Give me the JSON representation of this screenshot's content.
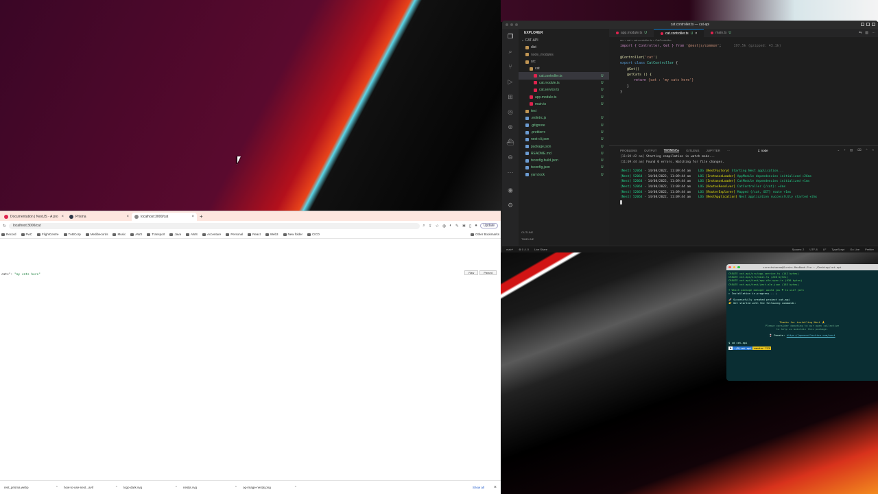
{
  "browser": {
    "tabs": [
      {
        "label": "Documentation | NestJS - A pro",
        "favicon_color": "#e0234e"
      },
      {
        "label": "Prisma",
        "favicon_color": "#2d3748"
      },
      {
        "label": "localhost:3000/cat",
        "favicon_color": "#888888"
      }
    ],
    "new_tab": "+",
    "url": "localhost:3000/cat",
    "update_label": "Update",
    "bookmarks": [
      "Record",
      "PwC",
      "FlightCentre",
      "TABCorp",
      "Medibecords",
      "Music",
      "AWS",
      "Transport",
      "Java",
      "AWS",
      "Accenture",
      "Personal",
      "React",
      "Web3",
      "New folder",
      "CICD"
    ],
    "other_bookmarks": "Other Bookmarks",
    "page": {
      "key": "cats\":",
      "value": "\"my cats here\""
    },
    "raw_label": "Raw",
    "pretty_label": "Parsed",
    "downloads": [
      "rest_prisma.webp",
      "how-to-use-nest...avif",
      "logo-dark.svg",
      "nestjs.svg",
      "og-image-nestjs.png"
    ],
    "show_all": "Show all"
  },
  "vscode": {
    "title": "cat.controller.ts — cat-api",
    "explorer_label": "EXPLORER",
    "project": "CAT-API",
    "tree": [
      {
        "name": "dist",
        "indent": 1,
        "color": "#c5c5c5",
        "status": ""
      },
      {
        "name": "node_modules",
        "indent": 1,
        "color": "#8a8a8a",
        "status": ""
      },
      {
        "name": "src",
        "indent": 1,
        "color": "#c5c5c5",
        "status": ""
      },
      {
        "name": "cat",
        "indent": 2,
        "color": "#c5c5c5",
        "status": ""
      },
      {
        "name": "cat.controller.ts",
        "indent": 3,
        "color": "#73c991",
        "status": "U",
        "selected": true
      },
      {
        "name": "cat.module.ts",
        "indent": 3,
        "color": "#73c991",
        "status": "U"
      },
      {
        "name": "cat.service.ts",
        "indent": 3,
        "color": "#73c991",
        "status": "U"
      },
      {
        "name": "app.module.ts",
        "indent": 2,
        "color": "#73c991",
        "status": "U"
      },
      {
        "name": "main.ts",
        "indent": 2,
        "color": "#73c991",
        "status": "U"
      },
      {
        "name": "test",
        "indent": 1,
        "color": "#73c991",
        "status": ""
      },
      {
        "name": ".eslintrc.js",
        "indent": 1,
        "color": "#73c991",
        "status": "U"
      },
      {
        "name": ".gitignore",
        "indent": 1,
        "color": "#73c991",
        "status": "U"
      },
      {
        "name": ".prettierrc",
        "indent": 1,
        "color": "#73c991",
        "status": "U"
      },
      {
        "name": "nest-cli.json",
        "indent": 1,
        "color": "#73c991",
        "status": "U"
      },
      {
        "name": "package.json",
        "indent": 1,
        "color": "#73c991",
        "status": "U"
      },
      {
        "name": "README.md",
        "indent": 1,
        "color": "#73c991",
        "status": "U"
      },
      {
        "name": "tsconfig.build.json",
        "indent": 1,
        "color": "#73c991",
        "status": "U"
      },
      {
        "name": "tsconfig.json",
        "indent": 1,
        "color": "#73c991",
        "status": "U"
      },
      {
        "name": "yarn.lock",
        "indent": 1,
        "color": "#73c991",
        "status": "U"
      }
    ],
    "outline_label": "OUTLINE",
    "timeline_label": "TIMELINE",
    "editor_tabs": [
      {
        "label": "app.module.ts",
        "status": "U",
        "active": false
      },
      {
        "label": "cat.controller.ts",
        "status": "U",
        "active": true
      },
      {
        "label": "main.ts",
        "status": "U",
        "active": false
      }
    ],
    "breadcrumb": "src > cat > cat.controller.ts > CatController",
    "code": {
      "line1_a": "import { Controller, Get } from ",
      "line1_b": "'@nestjs/common'",
      "line1_c": ";",
      "line1_hint": "197.5k (gzipped: 43.1k)",
      "line3_a": "@Controller(",
      "line3_b": "'cat'",
      "line3_c": ")",
      "line4_a": "export class ",
      "line4_b": "CatController",
      "line4_c": " {",
      "line5": "@Get()",
      "line6": "getCats () {",
      "line7_a": "return ",
      "line7_b": "{cat : 'my cats here'}",
      "line8": "}",
      "line9": "}"
    },
    "panel_tabs": [
      "PROBLEMS",
      "OUTPUT",
      "TERMINAL",
      "GITLENS",
      "JUPYTER",
      "···"
    ],
    "panel_active": "TERMINAL",
    "terminal_name": "1: node",
    "terminal_lines": [
      {
        "gray": "[11:09:42 am]",
        "text": " Starting compilation in watch mode..."
      },
      {
        "gray": "[11:09:44 am]",
        "text": " Found 0 errors. Watching for file changes."
      }
    ],
    "nest_logs": [
      {
        "pid": "[Nest] 52064",
        "time": "14/08/2022, 11:09:44 am",
        "ctx": "[NestFactory]",
        "msg": "Starting Nest application..."
      },
      {
        "pid": "[Nest] 52064",
        "time": "14/08/2022, 11:09:44 am",
        "ctx": "[InstanceLoader]",
        "msg": "AppModule dependencies initialized +26ms"
      },
      {
        "pid": "[Nest] 52064",
        "time": "14/08/2022, 11:09:44 am",
        "ctx": "[InstanceLoader]",
        "msg": "CatModule dependencies initialized +1ms"
      },
      {
        "pid": "[Nest] 52064",
        "time": "14/08/2022, 11:09:44 am",
        "ctx": "[RoutesResolver]",
        "msg": "CatController {/cat}: +4ms"
      },
      {
        "pid": "[Nest] 52064",
        "time": "14/08/2022, 11:09:44 am",
        "ctx": "[RouterExplorer]",
        "msg": "Mapped {/cat, GET} route +1ms"
      },
      {
        "pid": "[Nest] 52064",
        "time": "14/08/2022, 11:09:44 am",
        "ctx": "[NestApplication]",
        "msg": "Nest application successfully started +2ms"
      }
    ],
    "status_left": [
      "main*",
      "⊗ 0 ⚠ 0",
      "Live Share"
    ],
    "status_right": [
      "Spaces: 2",
      "UTF-8",
      "LF",
      "TypeScript",
      "Go Live",
      "Prettier"
    ]
  },
  "terminal": {
    "title": "sureshsharma@Surshs-MacBook-Pro ~ /Desktop/cat-api",
    "lines": [
      {
        "cls": "c-grn",
        "text": "CREATE cat-api/src/app.service.ts (142 bytes)"
      },
      {
        "cls": "c-grn",
        "text": "CREATE cat-api/src/main.ts (208 bytes)"
      },
      {
        "cls": "c-grn",
        "text": "CREATE cat-api/test/app.e2e-spec.ts (630 bytes)"
      },
      {
        "cls": "c-grn",
        "text": "CREATE cat-api/test/jest-e2e.json (183 bytes)"
      }
    ],
    "question": "? Which package manager would you ♥ to use? yarn",
    "installing": "▹ Installation in progress... ☕",
    "success": "🚀  Successfully created project cat-api",
    "get_started": "👉  Get started with the following commands:",
    "thanks": "Thanks for installing Nest 🙏",
    "consider1": "Please consider donating to our open collective",
    "consider2": "to help us maintain this package.",
    "donate_label": "🍷  Donate:",
    "donate_url": "https://opencollective.com/nest",
    "cd_line": "$ cd cat-api",
    "prompt1": "☻",
    "prompt2": "~/D/cat-api",
    "prompt3": "master ?13"
  }
}
